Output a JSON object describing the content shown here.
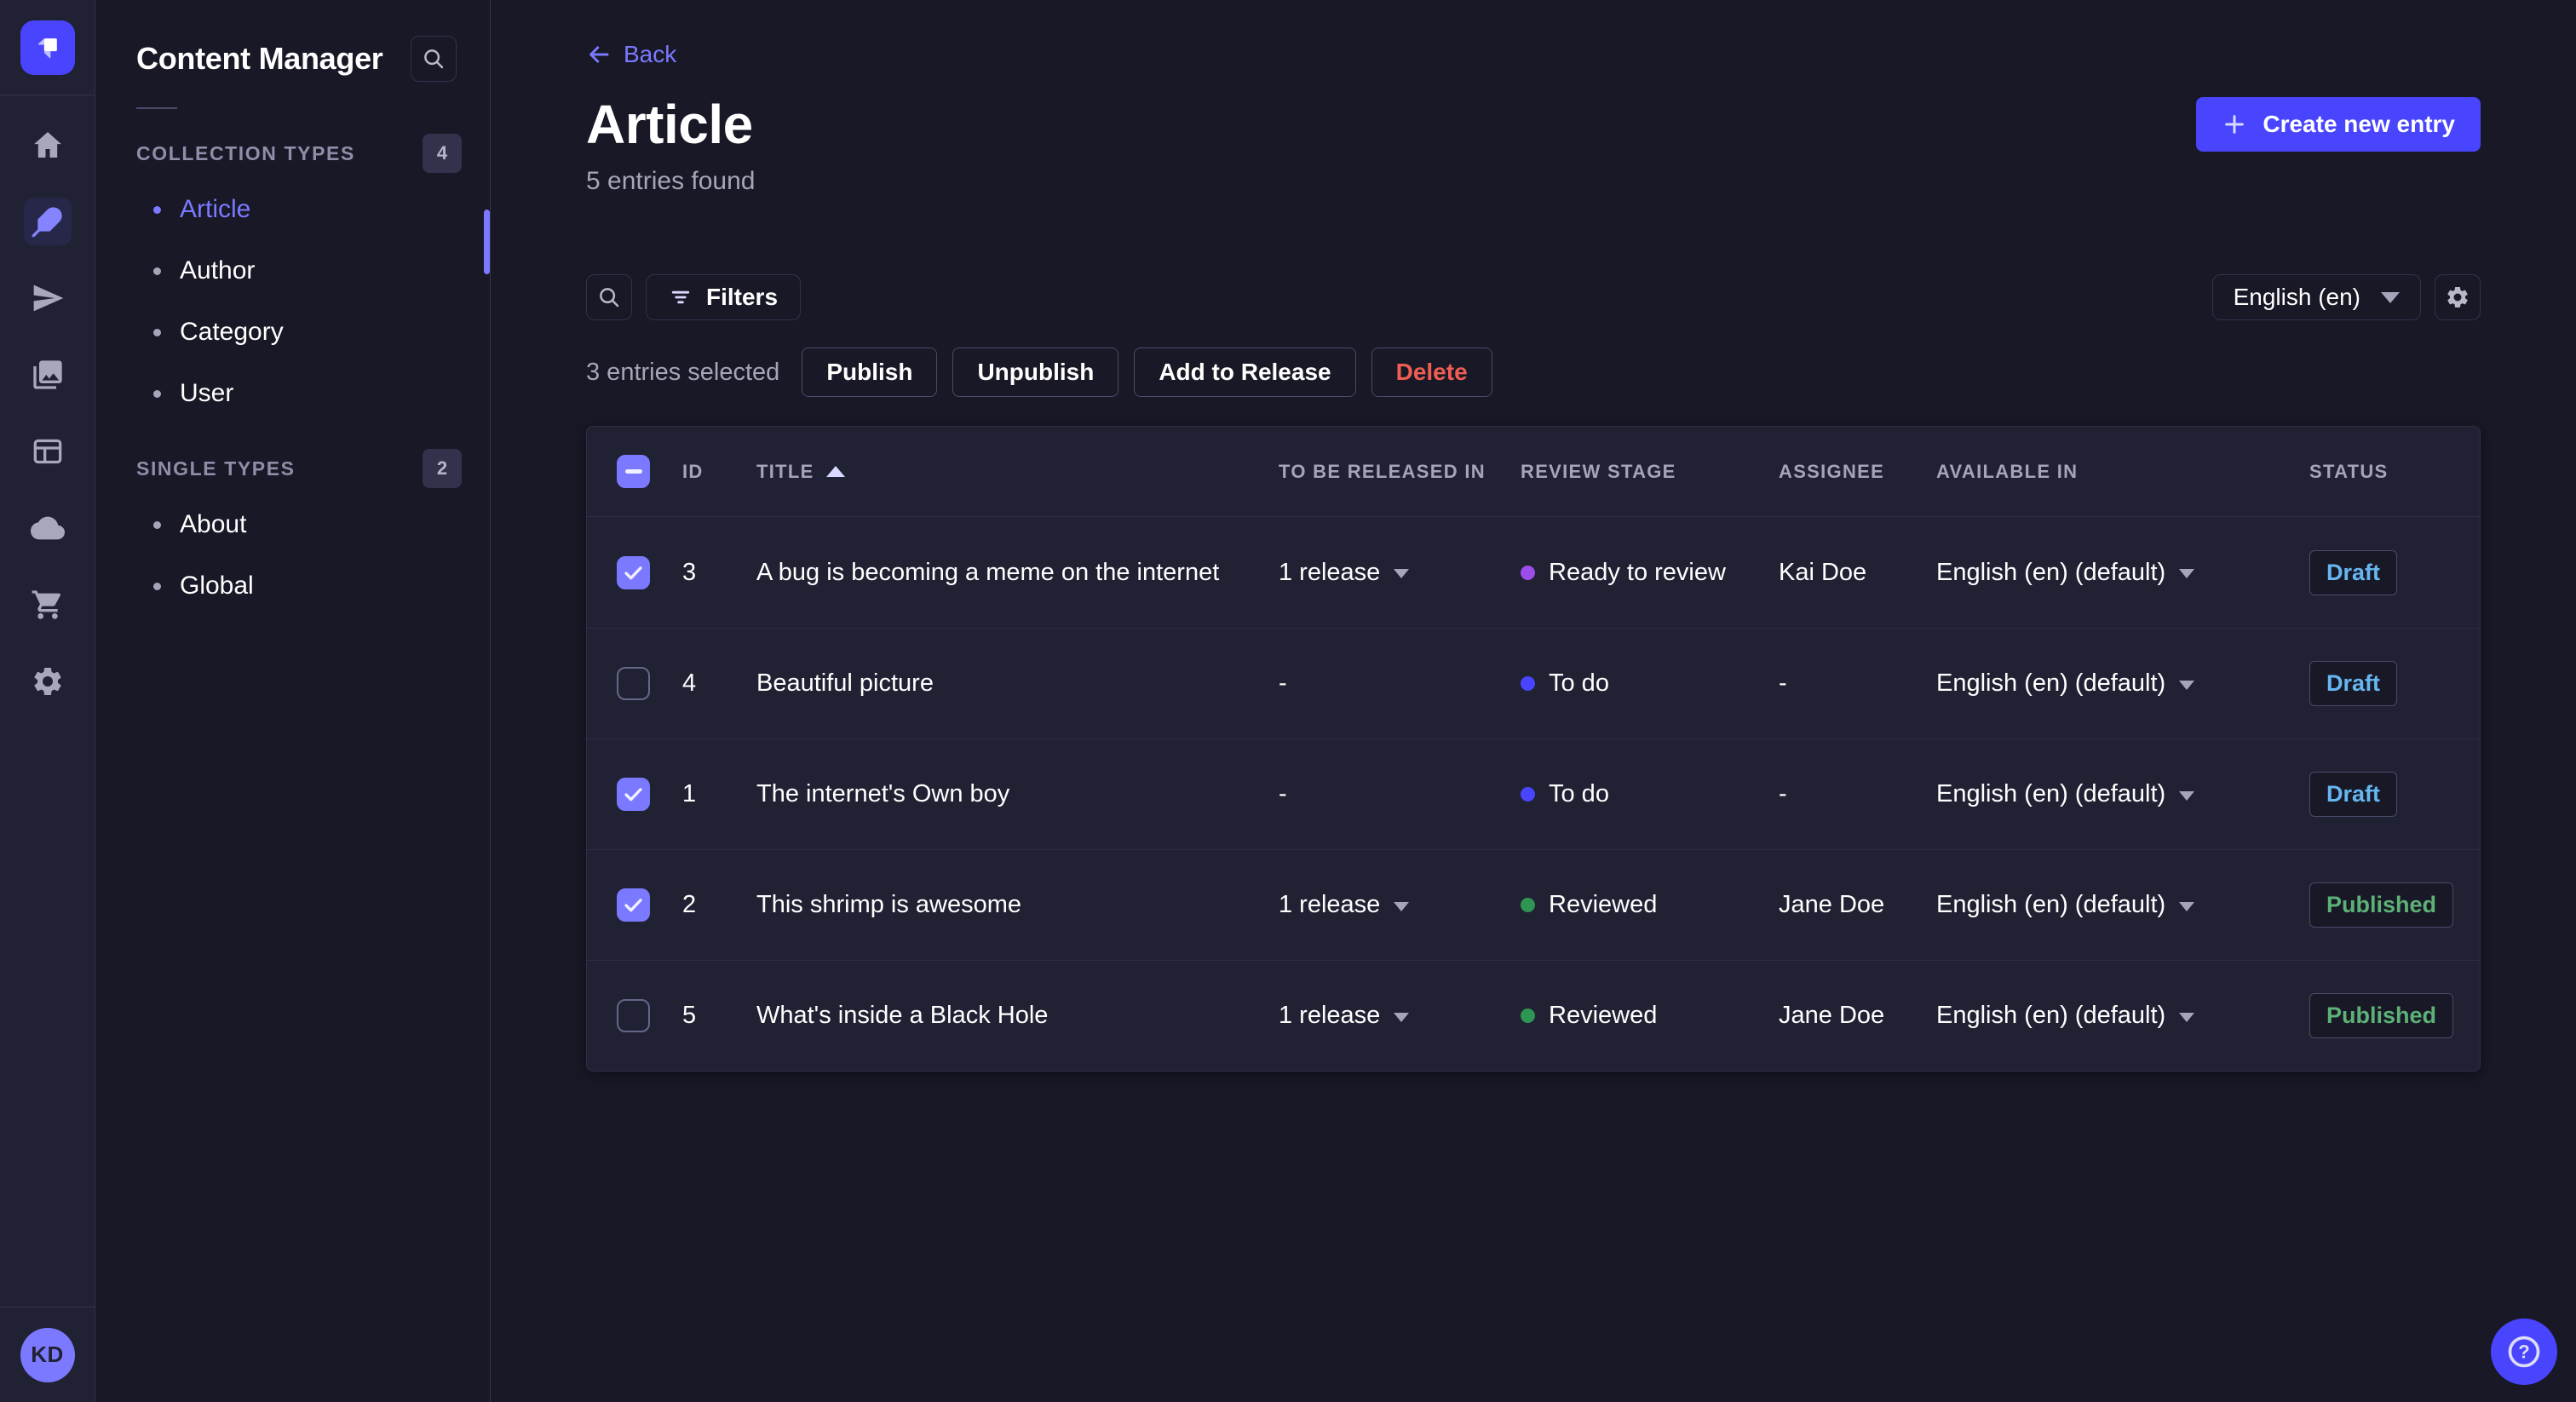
{
  "colors": {
    "primary": "#4945ff",
    "primary_light": "#7b79ff",
    "page_bg": "#181826",
    "card_bg": "#212134",
    "draft": "#66b7f1",
    "published": "#5cb176",
    "danger": "#ee5e52"
  },
  "rail": {
    "icons": [
      "strapi-logo",
      "home",
      "content-manager",
      "releases",
      "media-library",
      "content-type-builder",
      "deploy-cloud",
      "marketplace-cart",
      "settings-gear"
    ],
    "active_icon": "content-manager",
    "avatar_initials": "KD"
  },
  "sidebar": {
    "title": "Content Manager",
    "sections": [
      {
        "label": "COLLECTION TYPES",
        "count": "4",
        "items": [
          {
            "label": "Article",
            "active": true
          },
          {
            "label": "Author",
            "active": false
          },
          {
            "label": "Category",
            "active": false
          },
          {
            "label": "User",
            "active": false
          }
        ]
      },
      {
        "label": "SINGLE TYPES",
        "count": "2",
        "items": [
          {
            "label": "About",
            "active": false
          },
          {
            "label": "Global",
            "active": false
          }
        ]
      }
    ]
  },
  "header": {
    "back_label": "Back",
    "title": "Article",
    "subtitle": "5 entries found",
    "create_button": "Create new entry"
  },
  "toolbar": {
    "filters_label": "Filters",
    "locale_selected": "English (en)"
  },
  "selection": {
    "text": "3 entries selected",
    "publish_label": "Publish",
    "unpublish_label": "Unpublish",
    "add_to_release_label": "Add to Release",
    "delete_label": "Delete"
  },
  "table": {
    "select_all_state": "indeterminate",
    "columns": [
      {
        "label": "ID",
        "sorted": null
      },
      {
        "label": "TITLE",
        "sorted": "asc"
      },
      {
        "label": "TO BE RELEASED IN",
        "sorted": null
      },
      {
        "label": "REVIEW STAGE",
        "sorted": null
      },
      {
        "label": "ASSIGNEE",
        "sorted": null
      },
      {
        "label": "AVAILABLE IN",
        "sorted": null
      },
      {
        "label": "STATUS",
        "sorted": null
      }
    ],
    "rows": [
      {
        "checked": true,
        "id": "3",
        "title": "A bug is becoming a meme on the internet",
        "release": "1 release",
        "release_caret": true,
        "stage": {
          "label": "Ready to review",
          "color": "#9d4eea"
        },
        "assignee": "Kai Doe",
        "locale": "English (en) (default)",
        "status": {
          "label": "Draft",
          "type": "draft"
        }
      },
      {
        "checked": false,
        "id": "4",
        "title": "Beautiful picture",
        "release": "-",
        "release_caret": false,
        "stage": {
          "label": "To do",
          "color": "#4945ff"
        },
        "assignee": "-",
        "locale": "English (en) (default)",
        "status": {
          "label": "Draft",
          "type": "draft"
        }
      },
      {
        "checked": true,
        "id": "1",
        "title": "The internet's Own boy",
        "release": "-",
        "release_caret": false,
        "stage": {
          "label": "To do",
          "color": "#4945ff"
        },
        "assignee": "-",
        "locale": "English (en) (default)",
        "status": {
          "label": "Draft",
          "type": "draft"
        }
      },
      {
        "checked": true,
        "id": "2",
        "title": "This shrimp is awesome",
        "release": "1 release",
        "release_caret": true,
        "stage": {
          "label": "Reviewed",
          "color": "#2f9552"
        },
        "assignee": "Jane Doe",
        "locale": "English (en) (default)",
        "status": {
          "label": "Published",
          "type": "published"
        }
      },
      {
        "checked": false,
        "id": "5",
        "title": "What's inside a Black Hole",
        "release": "1 release",
        "release_caret": true,
        "stage": {
          "label": "Reviewed",
          "color": "#2f9552"
        },
        "assignee": "Jane Doe",
        "locale": "English (en) (default)",
        "status": {
          "label": "Published",
          "type": "published"
        }
      }
    ]
  },
  "fab": {
    "icon": "help-question-icon"
  }
}
